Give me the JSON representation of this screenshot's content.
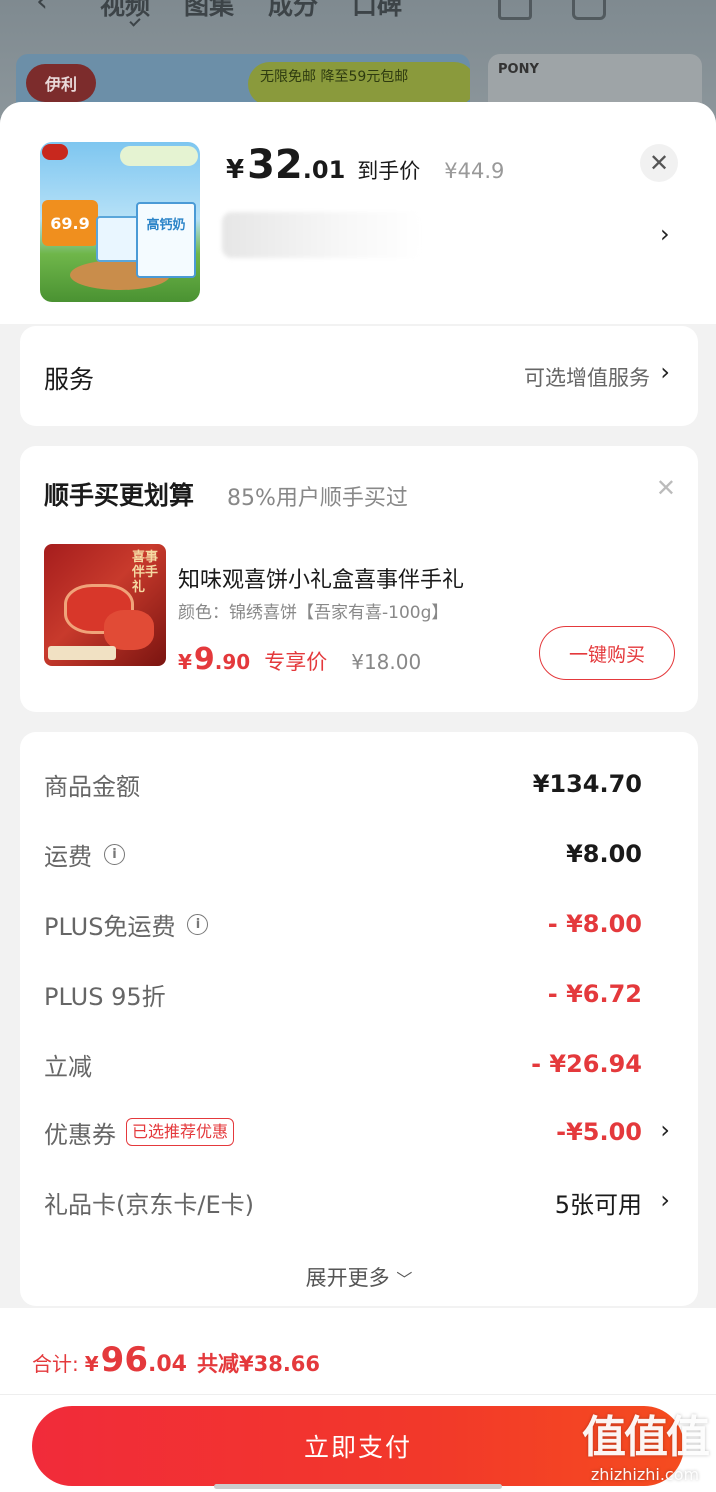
{
  "background": {
    "tabs": [
      "视频",
      "图集",
      "成分",
      "口碑"
    ],
    "banner_logo": "伊利",
    "banner_text": "无限免邮 降至59元包邮",
    "banner2_text": "PONY"
  },
  "product": {
    "price_symbol": "¥",
    "price_int": "32",
    "price_dec": ".01",
    "price_tag": "到手价",
    "original_price": "¥44.9",
    "thumb_badge": "69.9",
    "thumb_box_text": "高钙奶"
  },
  "service": {
    "title": "服务",
    "value": "可选增值服务"
  },
  "addon": {
    "title": "顺手买更划算",
    "subtitle": "85%用户顺手买过",
    "name": "知味观喜饼小礼盒喜事伴手礼",
    "spec": "颜色：锦绣喜饼【吾家有喜-100g】",
    "price_symbol": "¥",
    "price_int": "9",
    "price_dec": ".90",
    "price_label": "专享价",
    "original_price": "¥18.00",
    "buy_label": "一键购买",
    "img_text": "喜事伴手礼"
  },
  "summary": {
    "rows": [
      {
        "label": "商品金额",
        "value": "¥134.70"
      },
      {
        "label": "运费",
        "value": "¥8.00"
      },
      {
        "label": "PLUS免运费",
        "value": "- ¥8.00"
      },
      {
        "label": "PLUS 95折",
        "value": "- ¥6.72"
      },
      {
        "label": "立减",
        "value": "- ¥26.94"
      },
      {
        "label": "优惠券",
        "value": "-¥5.00",
        "badge": "已选推荐优惠"
      },
      {
        "label": "礼品卡(京东卡/E卡)",
        "value": "5张可用"
      }
    ],
    "expand_label": "展开更多"
  },
  "total": {
    "label": "合计:",
    "symbol": "¥",
    "int": "96",
    "dec": ".04",
    "saved": "共减¥38.66"
  },
  "pay_button": "立即支付",
  "watermark": {
    "logo": "值值值",
    "url": "zhizhizhi.com"
  },
  "colors": {
    "accent": "#e4393c",
    "pay_button": "#f12b3a"
  }
}
